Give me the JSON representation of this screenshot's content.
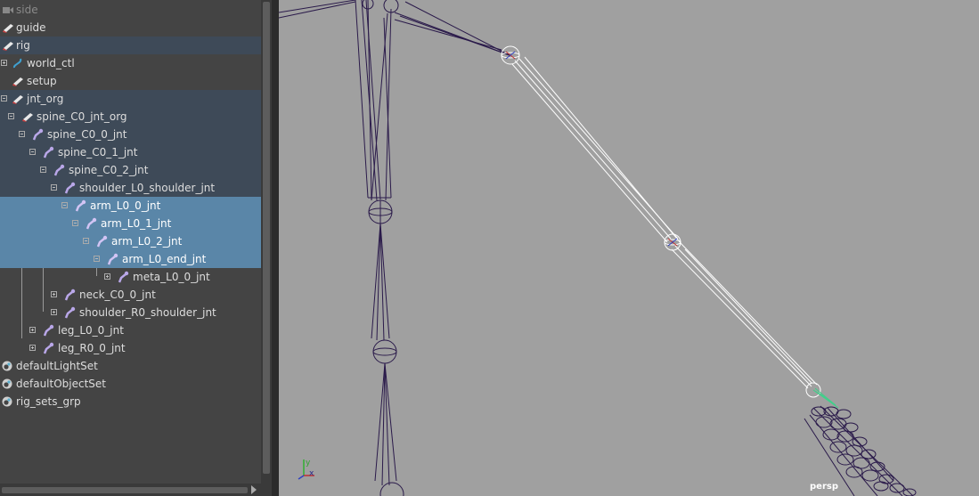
{
  "outliner": {
    "items": [
      {
        "label": "side",
        "icon": "camera-icon"
      },
      {
        "label": "guide",
        "icon": "transform-group-icon"
      },
      {
        "label": "rig",
        "icon": "transform-group-icon"
      },
      {
        "label": "world_ctl",
        "icon": "curve-icon"
      },
      {
        "label": "setup",
        "icon": "transform-group-icon"
      },
      {
        "label": "jnt_org",
        "icon": "transform-group-icon"
      },
      {
        "label": "spine_C0_jnt_org",
        "icon": "transform-group-icon"
      },
      {
        "label": "spine_C0_0_jnt",
        "icon": "joint-icon"
      },
      {
        "label": "spine_C0_1_jnt",
        "icon": "joint-icon"
      },
      {
        "label": "spine_C0_2_jnt",
        "icon": "joint-icon"
      },
      {
        "label": "shoulder_L0_shoulder_jnt",
        "icon": "joint-icon"
      },
      {
        "label": "arm_L0_0_jnt",
        "icon": "joint-icon"
      },
      {
        "label": "arm_L0_1_jnt",
        "icon": "joint-icon"
      },
      {
        "label": "arm_L0_2_jnt",
        "icon": "joint-icon"
      },
      {
        "label": "arm_L0_end_jnt",
        "icon": "joint-icon"
      },
      {
        "label": "meta_L0_0_jnt",
        "icon": "joint-icon"
      },
      {
        "label": "neck_C0_0_jnt",
        "icon": "joint-icon"
      },
      {
        "label": "shoulder_R0_shoulder_jnt",
        "icon": "joint-icon"
      },
      {
        "label": "leg_L0_0_jnt",
        "icon": "joint-icon"
      },
      {
        "label": "leg_R0_0_jnt",
        "icon": "joint-icon"
      },
      {
        "label": "defaultLightSet",
        "icon": "set-icon"
      },
      {
        "label": "defaultObjectSet",
        "icon": "set-icon"
      },
      {
        "label": "rig_sets_grp",
        "icon": "set-icon"
      }
    ]
  },
  "viewport": {
    "camera_label": "persp",
    "axis_x": "x",
    "axis_y": "y"
  },
  "colors": {
    "selected_row": "#5a86a8",
    "dim_row": "#3e4a58",
    "viewport_bg": "#a0a0a0",
    "joint_wire": "#2a1a4a",
    "selected_wire": "#ffffff"
  }
}
